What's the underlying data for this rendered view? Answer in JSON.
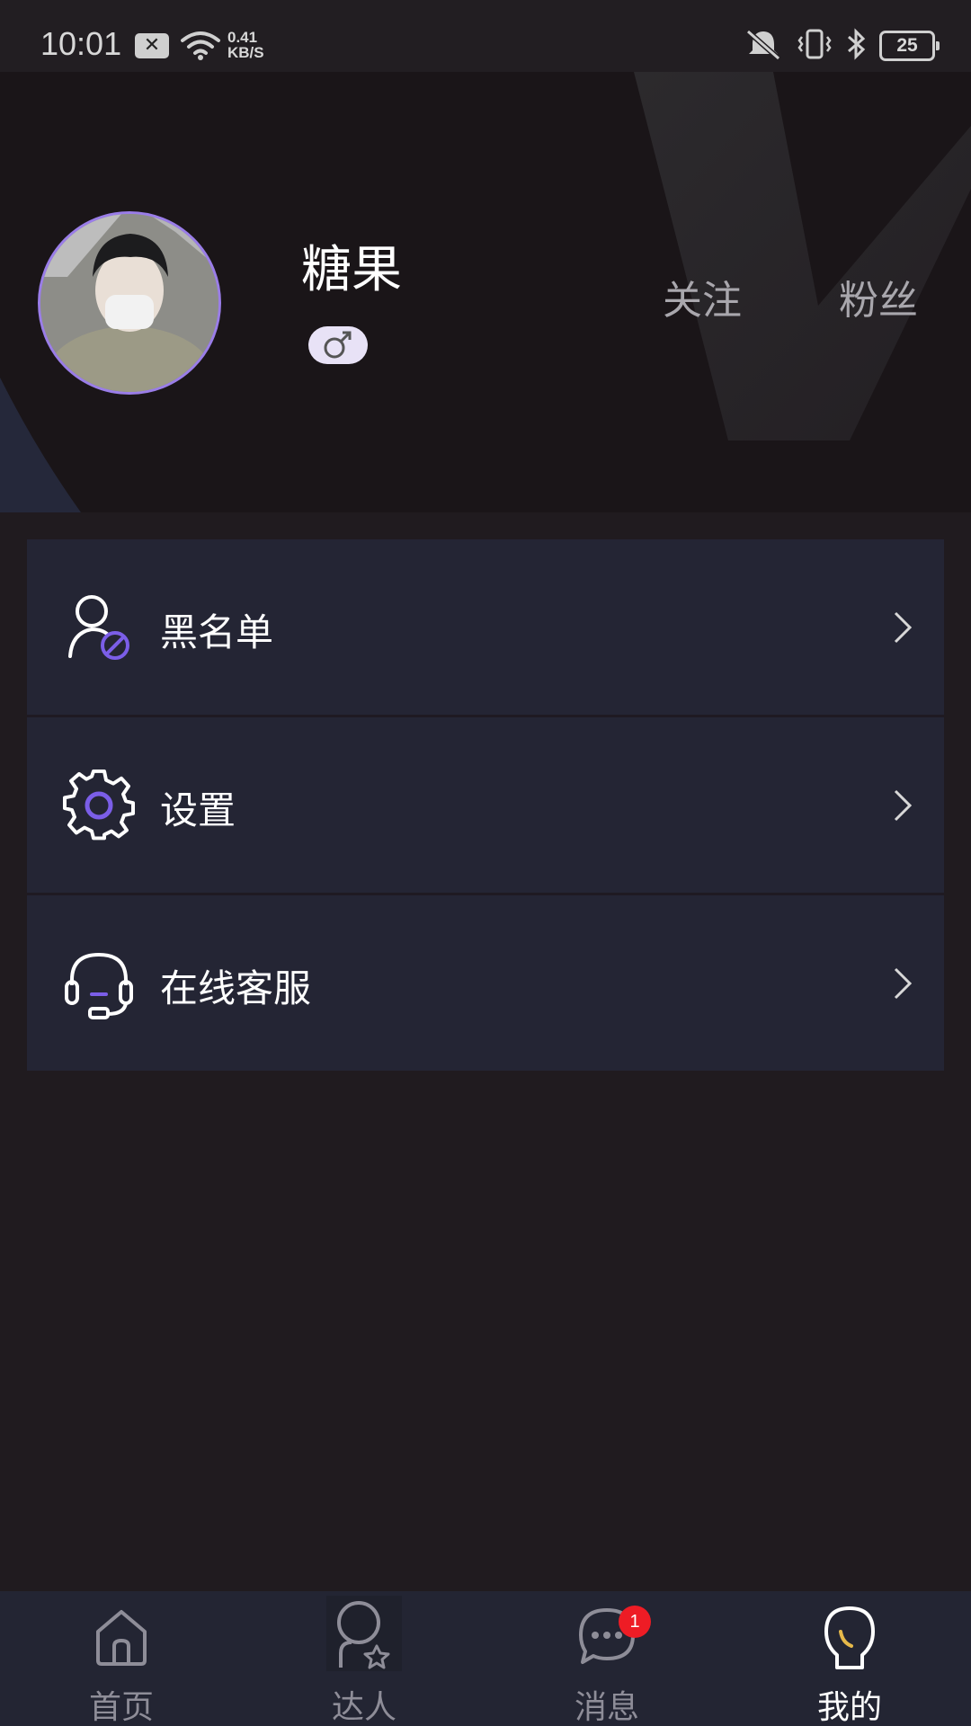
{
  "status_bar": {
    "time": "10:01",
    "speed_value": "0.41",
    "speed_unit": "KB/S",
    "battery": "25"
  },
  "profile": {
    "nickname": "糖果",
    "gender": "male",
    "follow_label": "关注",
    "fans_label": "粉丝"
  },
  "menu": {
    "items": [
      {
        "label": "黑名单",
        "icon": "user-block-icon"
      },
      {
        "label": "设置",
        "icon": "gear-icon"
      },
      {
        "label": "在线客服",
        "icon": "headset-icon"
      }
    ]
  },
  "bottom_nav": {
    "items": [
      {
        "label": "首页",
        "icon": "home-icon",
        "active": false
      },
      {
        "label": "达人",
        "icon": "talent-icon",
        "active": false
      },
      {
        "label": "消息",
        "icon": "message-icon",
        "active": false,
        "badge": "1"
      },
      {
        "label": "我的",
        "icon": "profile-icon",
        "active": true
      }
    ]
  },
  "colors": {
    "accent": "#7b5ee8",
    "page_bg": "#201b1f",
    "card_bg": "#242534",
    "badge": "#ee1c25"
  }
}
